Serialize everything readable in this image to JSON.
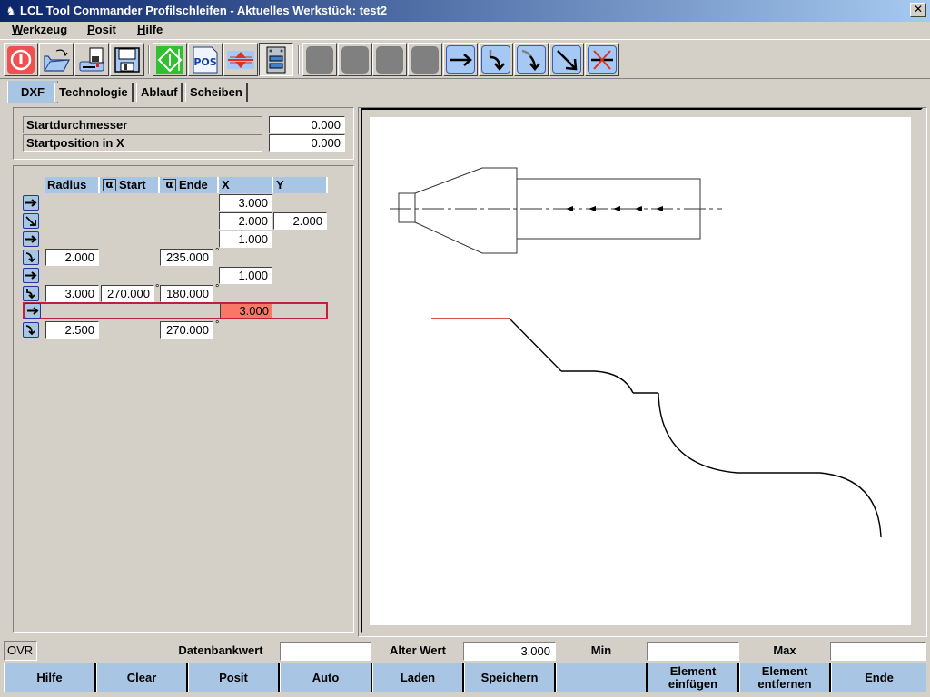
{
  "window": {
    "title": "LCL Tool Commander Profilschleifen - Aktuelles Werkstück: test2",
    "close_label": "✕"
  },
  "menu": [
    {
      "label_ul": "W",
      "label_rest": "erkzeug"
    },
    {
      "label_ul": "P",
      "label_rest": "osit"
    },
    {
      "label_ul": "H",
      "label_rest": "ilfe"
    }
  ],
  "toolbar": {
    "buttons": [
      {
        "icon": "power-icon"
      },
      {
        "icon": "open-folder-icon"
      },
      {
        "icon": "save-to-device-icon"
      },
      {
        "icon": "save-disk-icon"
      },
      {
        "icon": "run-icon"
      },
      {
        "icon": "pos-icon",
        "label": "POS"
      },
      {
        "icon": "transfer-icon"
      },
      {
        "icon": "database-icon",
        "pressed": true
      },
      {
        "icon": "disabled-1"
      },
      {
        "icon": "disabled-2"
      },
      {
        "icon": "disabled-3"
      },
      {
        "icon": "disabled-4"
      },
      {
        "icon": "line-horizontal-icon"
      },
      {
        "icon": "arc-concave-icon"
      },
      {
        "icon": "arc-convex-icon"
      },
      {
        "icon": "line-diagonal-icon"
      },
      {
        "icon": "delete-element-icon"
      }
    ]
  },
  "tabs": [
    {
      "label": "DXF",
      "active": true
    },
    {
      "label": "Technologie"
    },
    {
      "label": "Ablauf"
    },
    {
      "label": "Scheiben"
    }
  ],
  "start": {
    "diameter_label": "Startdurchmesser",
    "diameter_value": "0.000",
    "posx_label": "Startposition in X",
    "posx_value": "0.000"
  },
  "table": {
    "headers": {
      "radius": "Radius",
      "start": "Start",
      "end": "Ende",
      "x": "X",
      "y": "Y",
      "alpha": "α"
    },
    "degree": "°",
    "rows": [
      {
        "type": "line-horizontal",
        "radius": "",
        "start": "",
        "end": "",
        "x": "3.000",
        "y": ""
      },
      {
        "type": "line-diagonal",
        "radius": "",
        "start": "",
        "end": "",
        "x": "2.000",
        "y": "2.000"
      },
      {
        "type": "line-horizontal",
        "radius": "",
        "start": "",
        "end": "",
        "x": "1.000",
        "y": ""
      },
      {
        "type": "arc-convex",
        "radius": "2.000",
        "start": "",
        "end": "235.000",
        "x": "",
        "y": ""
      },
      {
        "type": "line-horizontal",
        "radius": "",
        "start": "",
        "end": "",
        "x": "1.000",
        "y": ""
      },
      {
        "type": "arc-concave",
        "radius": "3.000",
        "start": "270.000",
        "end": "180.000",
        "x": "",
        "y": ""
      },
      {
        "type": "line-horizontal",
        "radius": "",
        "start": "",
        "end": "",
        "x": "3.000",
        "y": "",
        "selected": true
      },
      {
        "type": "arc-convex",
        "radius": "2.500",
        "start": "",
        "end": "270.000",
        "x": "",
        "y": ""
      }
    ]
  },
  "status": {
    "ovr": "OVR",
    "db_label": "Datenbankwert",
    "db_value": "",
    "old_label": "Alter Wert",
    "old_value": "3.000",
    "min_label": "Min",
    "min_value": "",
    "max_label": "Max",
    "max_value": ""
  },
  "fkeys": [
    "Hilfe",
    "Clear",
    "Posit",
    "Auto",
    "Laden",
    "Speichern",
    "",
    "Element\neinfügen",
    "Element\nentfernen",
    "Ende"
  ],
  "colors": {
    "accent": "#a9c5e4",
    "selection": "#c02040",
    "selected_cell": "#f87868",
    "profile_active": "#d01010"
  }
}
